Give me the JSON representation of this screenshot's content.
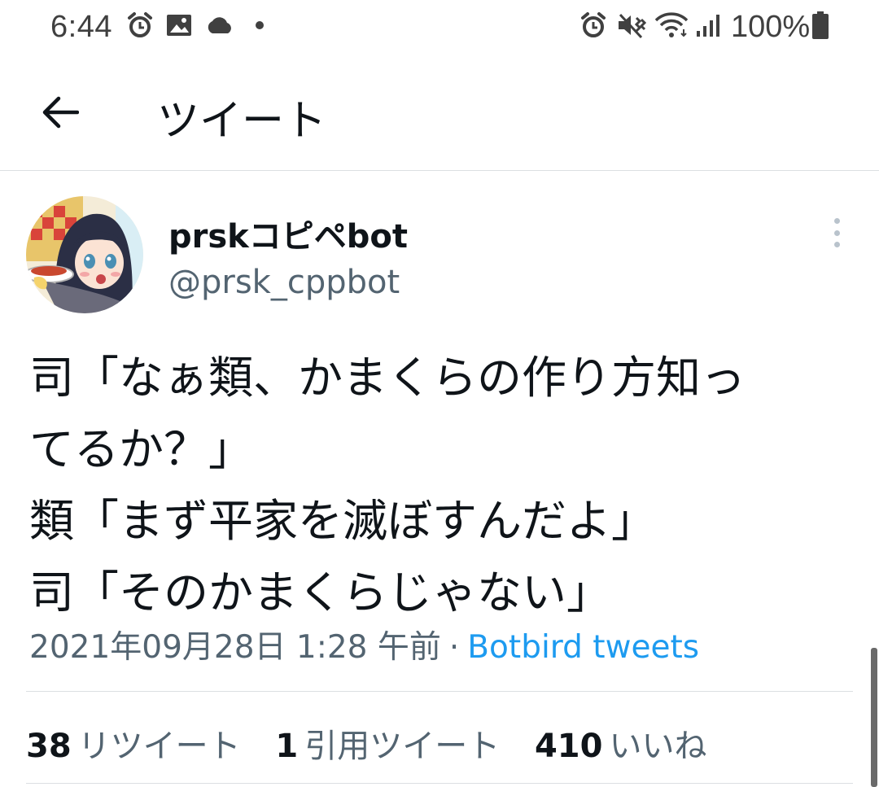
{
  "status_bar": {
    "time": "6:44",
    "left_icons": [
      "alarm-icon",
      "image-icon",
      "cloud-icon",
      "dot-icon"
    ],
    "right_icons": [
      "alarm-icon",
      "vibrate-mute-icon",
      "wifi-icon",
      "signal-icon",
      "battery-icon"
    ],
    "battery": "100%"
  },
  "header": {
    "back_icon": "arrow-left-icon",
    "title": "ツイート"
  },
  "tweet": {
    "author": {
      "display_name": "prskコピペbot",
      "handle": "@prsk_cppbot"
    },
    "more_icon": "more-vertical-icon",
    "lines": [
      "司「なぁ類、かまくらの作り方知っ",
      "てるか？」",
      "類「まず平家を滅ぼすんだよ」",
      "司「そのかまくらじゃない」"
    ],
    "timestamp": "2021年09月28日 1:28 午前",
    "separator": "·",
    "source": "Botbird tweets"
  },
  "stats": {
    "retweets_count": "38",
    "retweets_label": "リツイート",
    "quotes_count": "1",
    "quotes_label": "引用ツイート",
    "likes_count": "410",
    "likes_label": "いいね"
  },
  "colors": {
    "text": "#0f1419",
    "secondary": "#536471",
    "link": "#1d9bf0",
    "divider": "#dcdfe2"
  }
}
